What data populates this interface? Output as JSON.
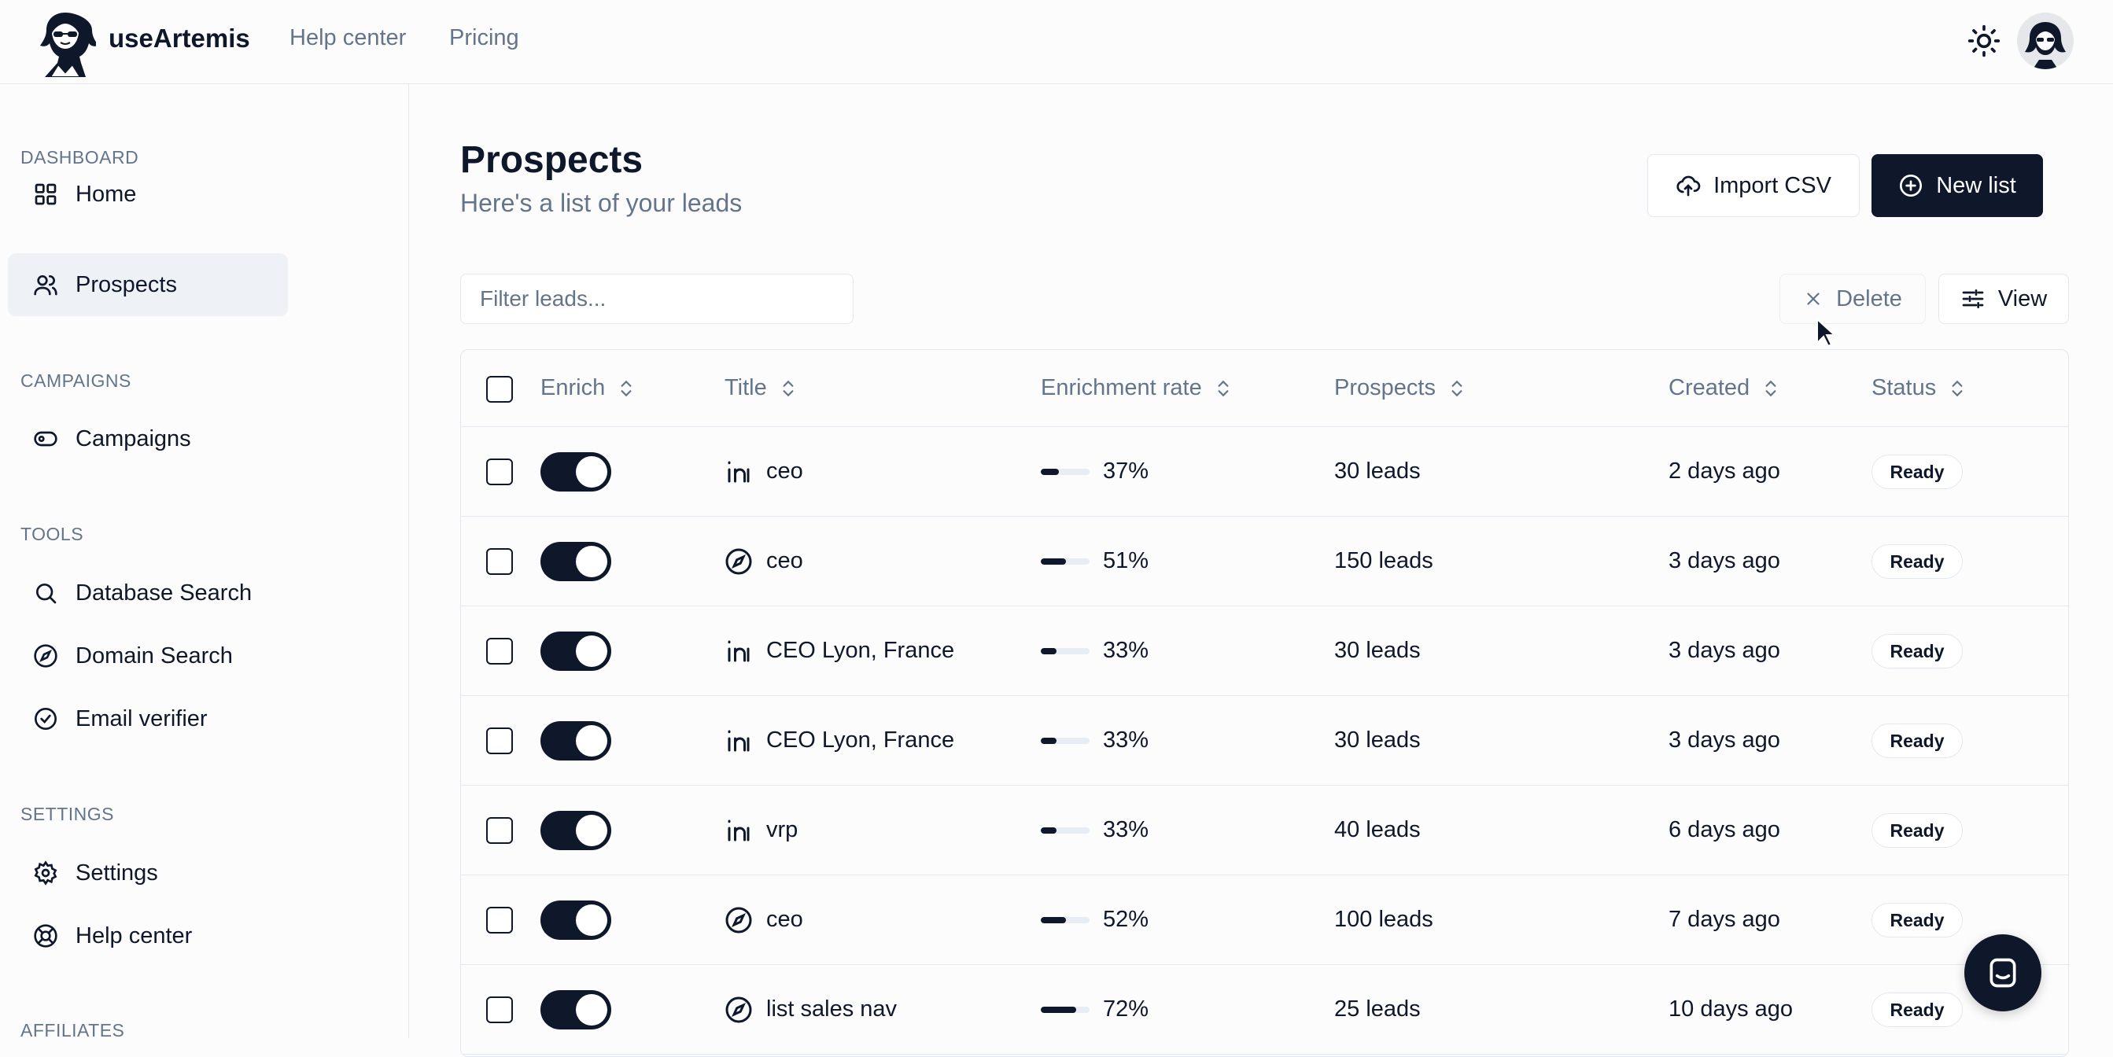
{
  "header": {
    "brand": "useArtemis",
    "nav": [
      "Help center",
      "Pricing"
    ]
  },
  "sidebar": {
    "sections": [
      {
        "title": "DASHBOARD",
        "items": [
          {
            "label": "Home",
            "icon": "grid-icon"
          },
          {
            "label": "Prospects",
            "icon": "users-icon",
            "active": true
          }
        ]
      },
      {
        "title": "CAMPAIGNS",
        "items": [
          {
            "label": "Campaigns",
            "icon": "toggle-icon"
          }
        ]
      },
      {
        "title": "TOOLS",
        "items": [
          {
            "label": "Database Search",
            "icon": "search-icon"
          },
          {
            "label": "Domain Search",
            "icon": "compass-icon"
          },
          {
            "label": "Email verifier",
            "icon": "badge-check-icon"
          }
        ]
      },
      {
        "title": "SETTINGS",
        "items": [
          {
            "label": "Settings",
            "icon": "gear-icon"
          },
          {
            "label": "Help center",
            "icon": "lifebuoy-icon"
          }
        ]
      },
      {
        "title": "AFFILIATES",
        "items": []
      }
    ]
  },
  "page": {
    "title": "Prospects",
    "subtitle": "Here's a list of your leads",
    "import_label": "Import CSV",
    "new_list_label": "New list",
    "filter_placeholder": "Filter leads...",
    "delete_label": "Delete",
    "view_label": "View"
  },
  "table": {
    "columns": [
      "Enrich",
      "Title",
      "Enrichment rate",
      "Prospects",
      "Created",
      "Status"
    ],
    "rows": [
      {
        "source": "linkedin-icon",
        "title": "ceo",
        "rate": "37%",
        "rate_value": 0.37,
        "prospects": "30 leads",
        "created": "2 days ago",
        "status": "Ready"
      },
      {
        "source": "compass-icon",
        "title": "ceo",
        "rate": "51%",
        "rate_value": 0.51,
        "prospects": "150 leads",
        "created": "3 days ago",
        "status": "Ready"
      },
      {
        "source": "linkedin-icon",
        "title": "CEO Lyon, France",
        "rate": "33%",
        "rate_value": 0.33,
        "prospects": "30 leads",
        "created": "3 days ago",
        "status": "Ready"
      },
      {
        "source": "linkedin-icon",
        "title": "CEO Lyon, France",
        "rate": "33%",
        "rate_value": 0.33,
        "prospects": "30 leads",
        "created": "3 days ago",
        "status": "Ready"
      },
      {
        "source": "linkedin-icon",
        "title": "vrp",
        "rate": "33%",
        "rate_value": 0.33,
        "prospects": "40 leads",
        "created": "6 days ago",
        "status": "Ready"
      },
      {
        "source": "compass-icon",
        "title": "ceo",
        "rate": "52%",
        "rate_value": 0.52,
        "prospects": "100 leads",
        "created": "7 days ago",
        "status": "Ready"
      },
      {
        "source": "compass-icon",
        "title": "list sales nav",
        "rate": "72%",
        "rate_value": 0.72,
        "prospects": "25 leads",
        "created": "10 days ago",
        "status": "Ready"
      }
    ]
  }
}
